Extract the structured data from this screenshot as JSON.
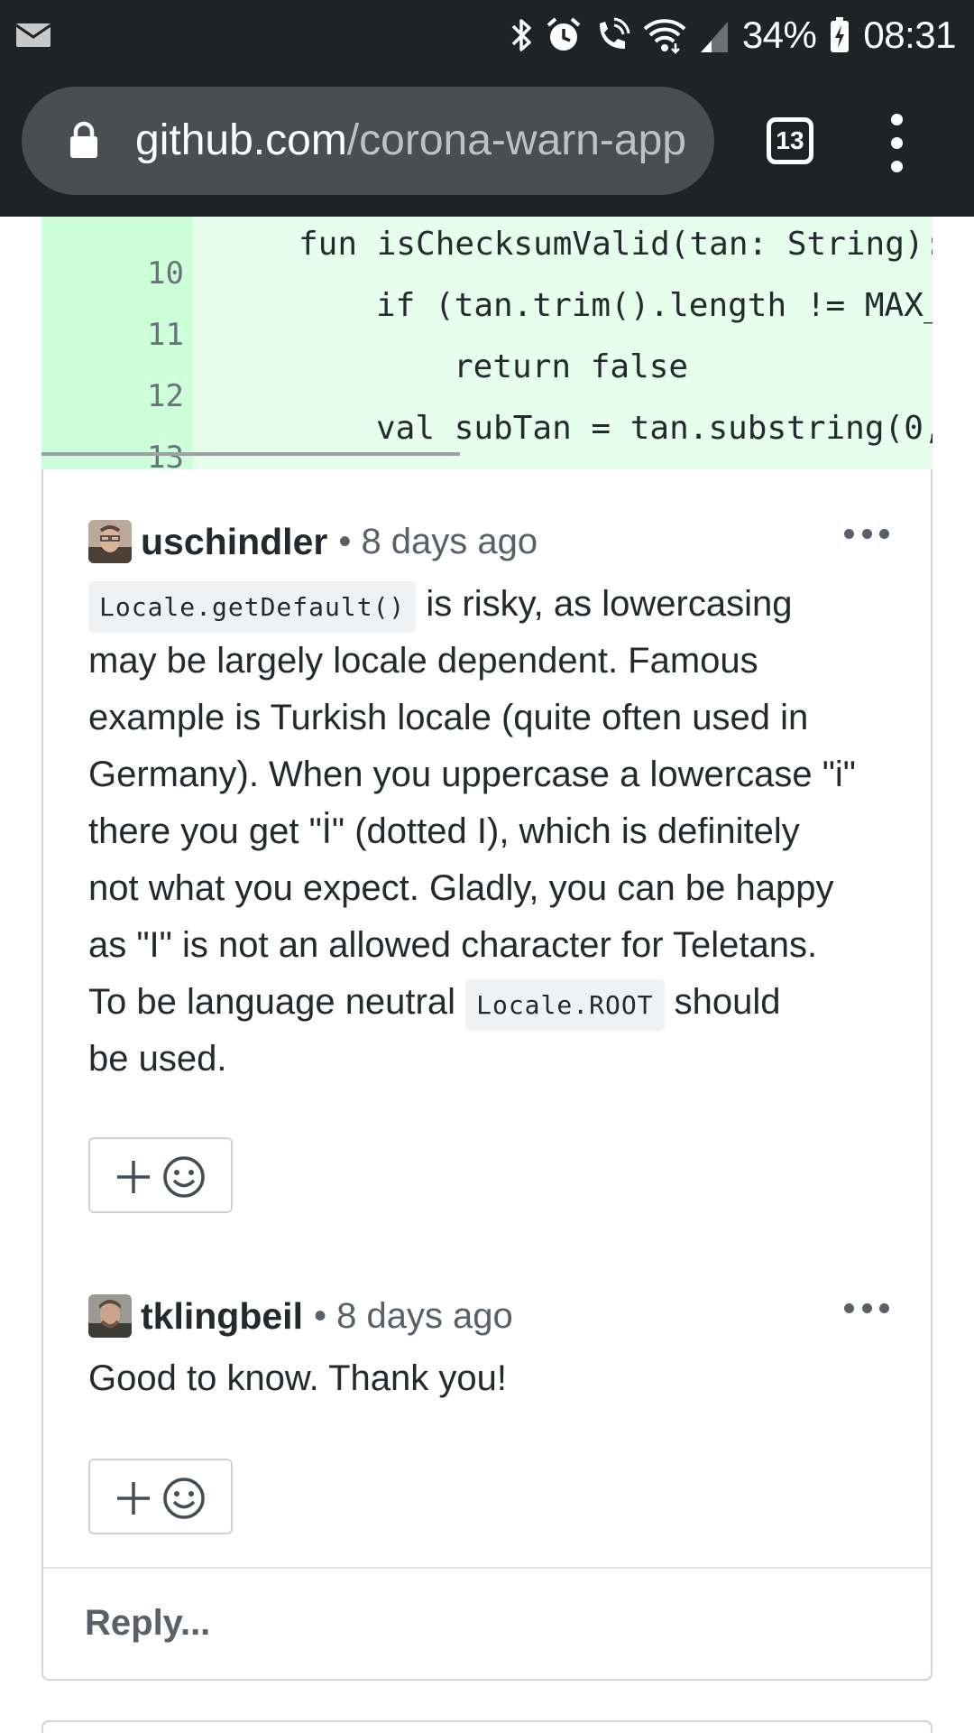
{
  "status_bar": {
    "battery_percent": "34%",
    "time": "08:31"
  },
  "browser": {
    "url_host": "github.com",
    "url_path": "/corona-warn-app",
    "tab_count": "13"
  },
  "code": {
    "lines": [
      {
        "num": "10",
        "text": "fun isChecksumValid(tan: String): ",
        "indent": 0
      },
      {
        "num": "11",
        "text": "if (tan.trim().length != MAX_",
        "indent": 1
      },
      {
        "num": "12",
        "text": "return false",
        "indent": 2
      },
      {
        "num": "13",
        "text": "val subTan = tan.substring(0,",
        "indent": 1
      }
    ]
  },
  "comments": [
    {
      "author": "uschindler",
      "meta": "• 8 days ago",
      "body": {
        "code1": "Locale.getDefault()",
        "l1_rest": " is risky, as lowercasing",
        "l2": "may be largely locale dependent. Famous",
        "l3": "example is Turkish locale (quite often used in",
        "l4": "Germany). When you uppercase a lowercase \"i\"",
        "l5": "there you get \"İ\" (dotted I), which is definitely",
        "l6": "not what you expect. Gladly, you can be happy",
        "l7": "as \"I\" is not an allowed character for Teletans.",
        "l8_pre": "To be language neutral ",
        "code2": "Locale.ROOT",
        "l8_post": " should",
        "l9": "be used."
      }
    },
    {
      "author": "tklingbeil",
      "meta": "• 8 days ago",
      "body": {
        "l1": "Good to know. Thank you!"
      }
    }
  ],
  "reply_placeholder": "Reply..."
}
